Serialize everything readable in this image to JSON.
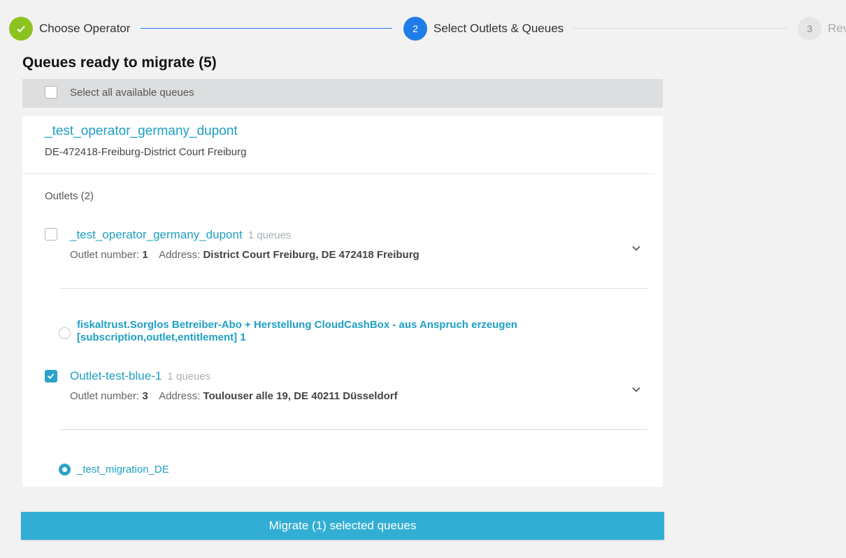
{
  "stepper": {
    "steps": [
      {
        "number": "✓",
        "label": "Choose Operator",
        "state": "done"
      },
      {
        "number": "2",
        "label": "Select Outlets & Queues",
        "state": "active"
      },
      {
        "number": "3",
        "label": "Rev",
        "state": "pending"
      }
    ]
  },
  "page_title": "Queues ready to migrate (5)",
  "select_all_label": "Select all available queues",
  "operator": {
    "name": "_test_operator_germany_dupont",
    "subtitle": "DE-472418-Freiburg-District Court Freiburg"
  },
  "outlets_heading": "Outlets (2)",
  "outlets": [
    {
      "name": "_test_operator_germany_dupont",
      "queue_count": "1 queues",
      "number_label": "Outlet number:",
      "number": "1",
      "address_label": "Address:",
      "address": "District Court Freiburg, DE 472418 Freiburg",
      "checked": false,
      "queue": {
        "label": "fiskaltrust.Sorglos Betreiber-Abo + Herstellung CloudCashBox - aus Anspruch erzeugen [subscription,outlet,entitlement] 1",
        "selected": false
      }
    },
    {
      "name": "Outlet-test-blue-1",
      "queue_count": "1 queues",
      "number_label": "Outlet number:",
      "number": "3",
      "address_label": "Address:",
      "address": "Toulouser alle 19, DE 40211 Düsseldorf",
      "checked": true,
      "queue": {
        "label": "_test_migration_DE",
        "selected": true
      }
    }
  ],
  "migrate_button_label": "Migrate (1) selected queues",
  "colors": {
    "accent": "#1ea0c4",
    "button": "#32aed4",
    "step_done": "#8dc21f",
    "step_active": "#1f7de8"
  }
}
